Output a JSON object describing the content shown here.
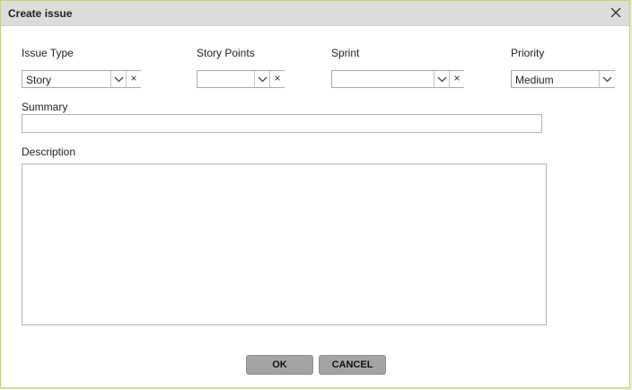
{
  "dialog": {
    "title": "Create issue",
    "close_icon": "close-icon"
  },
  "fields": {
    "issue_type": {
      "label": "Issue Type",
      "value": "Story"
    },
    "story_points": {
      "label": "Story Points",
      "value": ""
    },
    "sprint": {
      "label": "Sprint",
      "value": ""
    },
    "priority": {
      "label": "Priority",
      "value": "Medium"
    },
    "summary": {
      "label": "Summary",
      "value": ""
    },
    "description": {
      "label": "Description",
      "value": ""
    }
  },
  "icons": {
    "dropdown": "chevron-down-icon",
    "clear": "clear-icon",
    "clear_glyph": "×"
  },
  "buttons": {
    "ok": "OK",
    "cancel": "CANCEL"
  },
  "colors": {
    "titlebar": "#dcdcdc",
    "dialog_border": "#c5d36a",
    "button": "#a4a4a4"
  }
}
